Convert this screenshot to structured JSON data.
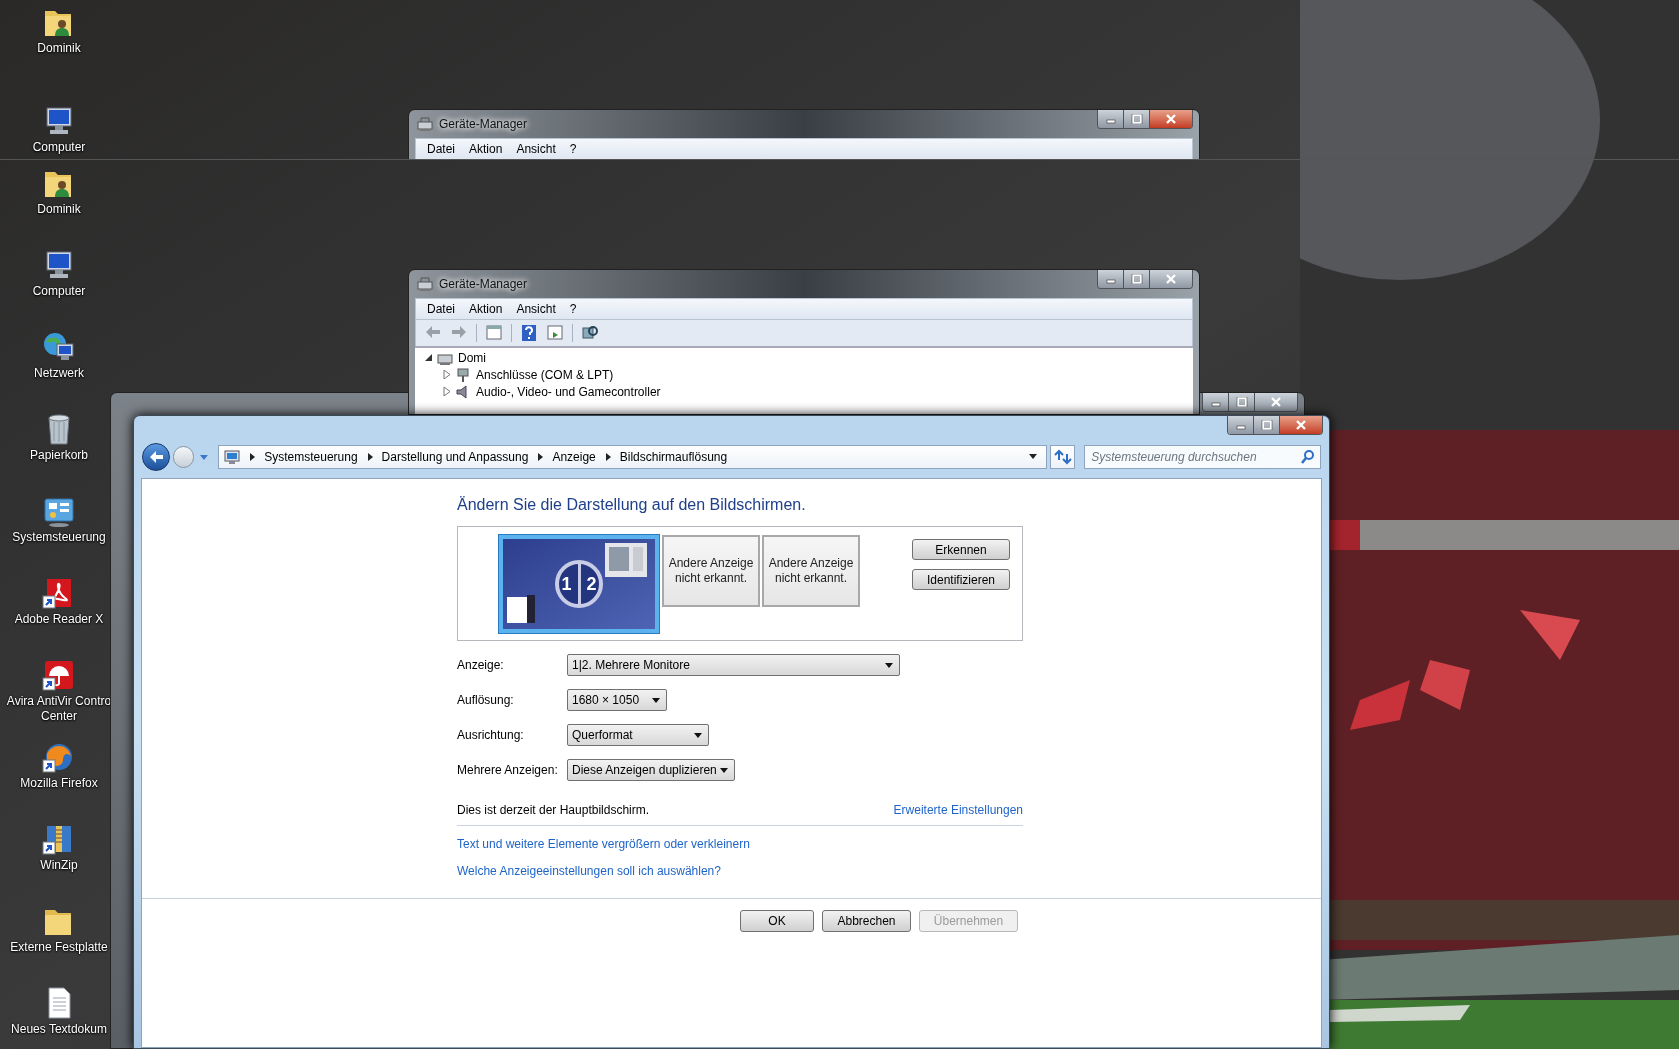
{
  "top_strip": {
    "desktop_icons": [
      {
        "label": "Dominik",
        "kind": "user-folder",
        "shortcut": false
      },
      {
        "label": "Computer",
        "kind": "computer",
        "shortcut": false
      }
    ],
    "device_manager": {
      "title": "Geräte-Manager",
      "menu": [
        "Datei",
        "Aktion",
        "Ansicht",
        "?"
      ]
    }
  },
  "desktop_icons": [
    {
      "label": "Dominik",
      "kind": "user-folder",
      "shortcut": false
    },
    {
      "label": "Computer",
      "kind": "computer",
      "shortcut": false
    },
    {
      "label": "Netzwerk",
      "kind": "network",
      "shortcut": false
    },
    {
      "label": "Papierkorb",
      "kind": "recycle-bin",
      "shortcut": false
    },
    {
      "label": "Systemsteuerung",
      "kind": "control-panel",
      "shortcut": false
    },
    {
      "label": "Adobe Reader X",
      "kind": "pdf",
      "shortcut": true
    },
    {
      "label": "Avira AntiVir Contro\nCenter",
      "kind": "umbrella",
      "shortcut": true
    },
    {
      "label": "Mozilla Firefox",
      "kind": "globe",
      "shortcut": true
    },
    {
      "label": "WinZip",
      "kind": "archive",
      "shortcut": true
    },
    {
      "label": "Externe Festplatte",
      "kind": "folder",
      "shortcut": false
    },
    {
      "label": "Neues Textdokum",
      "kind": "document",
      "shortcut": false
    }
  ],
  "device_manager": {
    "title": "Geräte-Manager",
    "menu": [
      "Datei",
      "Aktion",
      "Ansicht",
      "?"
    ],
    "tree": [
      {
        "label": "Domi",
        "kind": "computer",
        "expanded": true,
        "children": [
          {
            "label": "Anschlüsse (COM & LPT)",
            "kind": "port",
            "expanded": false
          },
          {
            "label": "Audio-, Video- und Gamecontroller",
            "kind": "speaker",
            "expanded": false
          }
        ]
      }
    ]
  },
  "display_window": {
    "breadcrumb": [
      "Systemsteuerung",
      "Darstellung und Anpassung",
      "Anzeige",
      "Bildschirmauflösung"
    ],
    "search": {
      "placeholder": "Systemsteuerung durchsuchen"
    },
    "heading": "Ändern Sie die Darstellung auf den Bildschirmen.",
    "monitors": [
      {
        "kind": "active",
        "numbers": [
          "1",
          "2"
        ],
        "selected": true
      },
      {
        "kind": "undetected",
        "label": "Andere Anzeige nicht erkannt.",
        "selected": false
      },
      {
        "kind": "undetected",
        "label": "Andere Anzeige nicht erkannt.",
        "selected": false
      }
    ],
    "monitor_buttons": [
      "Erkennen",
      "Identifizieren"
    ],
    "fields": [
      {
        "label": "Anzeige:",
        "value": "1|2. Mehrere Monitore"
      },
      {
        "label": "Auflösung:",
        "value": "1680 × 1050"
      },
      {
        "label": "Ausrichtung:",
        "value": "Querformat"
      },
      {
        "label": "Mehrere Anzeigen:",
        "value": "Diese Anzeigen duplizieren"
      }
    ],
    "status": "Dies ist derzeit der Hauptbildschirm.",
    "advanced_link": "Erweiterte Einstellungen",
    "links": [
      "Text und weitere Elemente vergrößern oder verkleinern",
      "Welche Anzeigeeinstellungen soll ich auswählen?"
    ],
    "buttons": [
      {
        "label": "OK",
        "disabled": false
      },
      {
        "label": "Abbrechen",
        "disabled": false
      },
      {
        "label": "Übernehmen",
        "disabled": true
      }
    ]
  }
}
